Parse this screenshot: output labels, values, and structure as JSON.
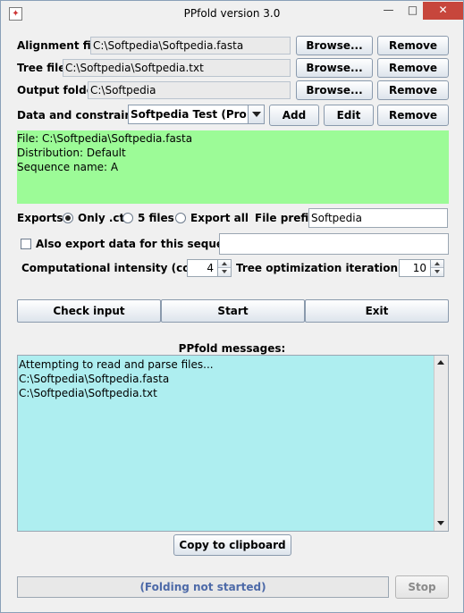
{
  "window": {
    "title": "PPfold version 3.0",
    "minimize": "—",
    "maximize": "□",
    "close": "✕"
  },
  "alignment": {
    "label": "Alignment file:",
    "value": "C:\\Softpedia\\Softpedia.fasta",
    "browse": "Browse...",
    "remove": "Remove"
  },
  "tree": {
    "label": "Tree file:",
    "value": "C:\\Softpedia\\Softpedia.txt",
    "browse": "Browse...",
    "remove": "Remove"
  },
  "output": {
    "label": "Output folder:",
    "value": "C:\\Softpedia",
    "browse": "Browse...",
    "remove": "Remove"
  },
  "constraints": {
    "label": "Data and constraints:",
    "selected": "Softpedia Test (Probi...",
    "add": "Add",
    "edit": "Edit",
    "remove": "Remove"
  },
  "info": {
    "file": "File: C:\\Softpedia\\Softpedia.fasta",
    "distribution": "Distribution: Default",
    "sequence": "Sequence name: A"
  },
  "exports": {
    "label": "Exports:",
    "options": [
      "Only .ct",
      "5 files",
      "Export all"
    ],
    "selected_index": 0,
    "prefix_label": "File prefix:",
    "prefix_value": "Softpedia"
  },
  "also_export": {
    "label": "Also export data for this sequence:",
    "checked": false,
    "value": ""
  },
  "intensity": {
    "label": "Computational intensity (cores):",
    "value": "4"
  },
  "tree_opt": {
    "label": "Tree optimization iteration limit:",
    "value": "10"
  },
  "actions": {
    "check": "Check input",
    "start": "Start",
    "exit": "Exit"
  },
  "messages": {
    "title": "PPfold messages:",
    "lines": [
      "Attempting to read and parse files...",
      "C:\\Softpedia\\Softpedia.fasta",
      "C:\\Softpedia\\Softpedia.txt"
    ],
    "copy": "Copy to clipboard"
  },
  "status": {
    "text": "(Folding not started)",
    "progress": 0,
    "stop": "Stop"
  },
  "colors": {
    "info_bg": "#9cfb97",
    "messages_bg": "#aeeef0",
    "status_text": "#4d6aa8"
  }
}
